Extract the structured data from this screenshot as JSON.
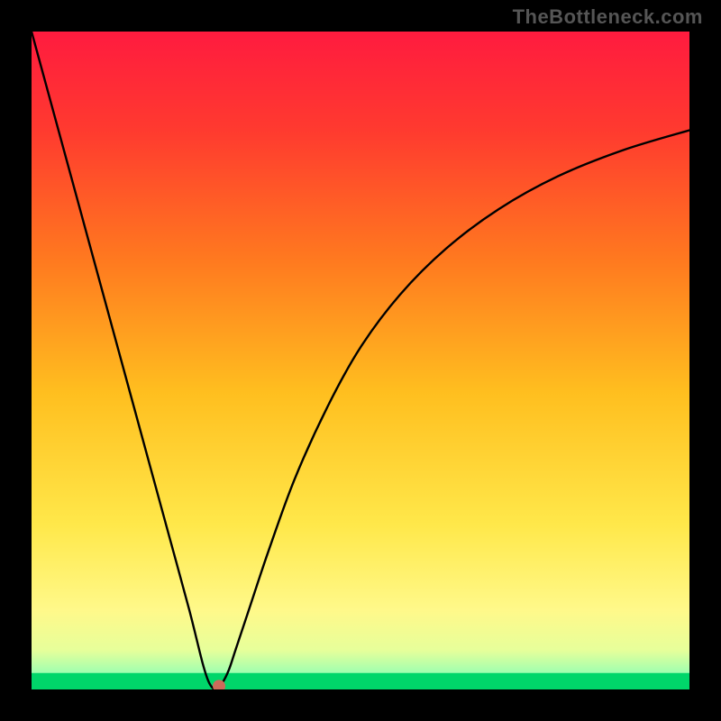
{
  "watermark": "TheBottleneck.com",
  "chart_data": {
    "type": "line",
    "title": "",
    "subtitle": "",
    "xlabel": "",
    "ylabel": "",
    "xlim": [
      0,
      100
    ],
    "ylim": [
      0,
      100
    ],
    "grid": false,
    "legend": false,
    "background": {
      "type": "vertical-gradient-with-thin-green-base",
      "gradient_stops": [
        {
          "pos": 0.0,
          "color": "#ff1b3f"
        },
        {
          "pos": 0.15,
          "color": "#ff3a2f"
        },
        {
          "pos": 0.35,
          "color": "#ff7a1f"
        },
        {
          "pos": 0.55,
          "color": "#ffbf1f"
        },
        {
          "pos": 0.75,
          "color": "#ffe84a"
        },
        {
          "pos": 0.88,
          "color": "#fff98a"
        },
        {
          "pos": 0.94,
          "color": "#e7ff9a"
        },
        {
          "pos": 0.975,
          "color": "#9fffb0"
        },
        {
          "pos": 1.0,
          "color": "#00e676"
        }
      ],
      "green_band_fraction": 0.025
    },
    "series": [
      {
        "name": "bottleneck-curve",
        "type": "line",
        "color": "#000000",
        "x": [
          0,
          3,
          6,
          9,
          12,
          15,
          18,
          21,
          24,
          26,
          27,
          28,
          29,
          30,
          31,
          33,
          36,
          40,
          45,
          50,
          56,
          63,
          71,
          80,
          90,
          100
        ],
        "y": [
          100,
          89,
          78,
          67,
          56,
          45,
          34,
          23,
          12,
          4,
          1,
          0,
          1,
          3,
          6,
          12,
          21,
          32,
          43,
          52,
          60,
          67,
          73,
          78,
          82,
          85
        ]
      }
    ],
    "annotations": [
      {
        "name": "optimal-point",
        "type": "point",
        "x": 28.5,
        "y": 0.5,
        "color": "#cc6b5a",
        "radius_px": 7
      }
    ]
  }
}
